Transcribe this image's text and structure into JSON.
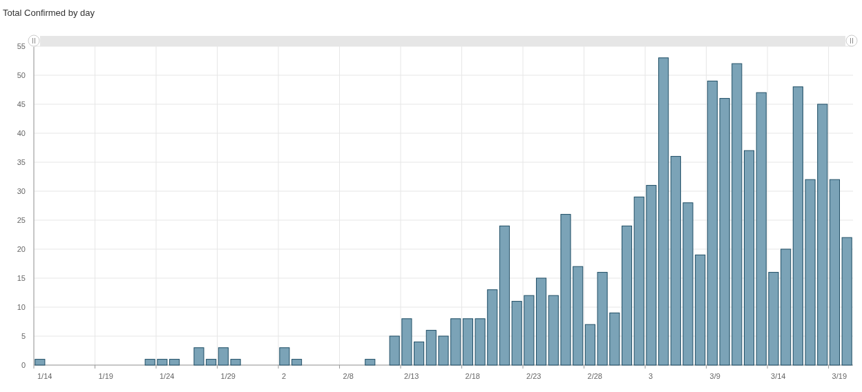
{
  "title": "Total Confirmed by day",
  "chart_data": {
    "type": "bar",
    "categories": [
      "1/14",
      null,
      null,
      null,
      null,
      "1/19",
      null,
      null,
      null,
      null,
      "1/24",
      null,
      null,
      null,
      null,
      "1/29",
      null,
      null,
      null,
      null,
      "2",
      null,
      null,
      null,
      null,
      "2/8",
      null,
      null,
      null,
      null,
      "2/13",
      null,
      null,
      null,
      null,
      "2/18",
      null,
      null,
      null,
      null,
      "2/23",
      null,
      null,
      null,
      null,
      "2/28",
      null,
      null,
      null,
      null,
      "3",
      null,
      null,
      null,
      null,
      "3/9",
      null,
      null,
      null,
      null,
      "3/14",
      null,
      null,
      null,
      null,
      "3/19",
      null
    ],
    "values": [
      1,
      0,
      0,
      0,
      0,
      0,
      0,
      0,
      0,
      1,
      1,
      1,
      0,
      3,
      1,
      3,
      1,
      0,
      0,
      0,
      3,
      1,
      0,
      0,
      0,
      0,
      0,
      1,
      0,
      5,
      8,
      4,
      6,
      5,
      8,
      8,
      8,
      13,
      24,
      11,
      12,
      15,
      12,
      26,
      17,
      7,
      16,
      9,
      24,
      29,
      31,
      53,
      36,
      28,
      19,
      49,
      46,
      52,
      37,
      47,
      16,
      20,
      48,
      32,
      45,
      32,
      22
    ],
    "ylim": [
      0,
      55
    ],
    "yticks": [
      0,
      5,
      10,
      15,
      20,
      25,
      30,
      35,
      40,
      45,
      50,
      55
    ],
    "grid": true
  }
}
